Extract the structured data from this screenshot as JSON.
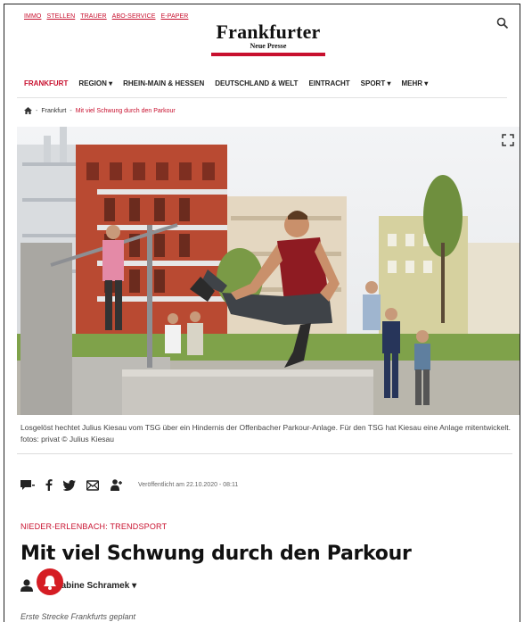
{
  "header": {
    "top_links": [
      "IMMO",
      "STELLEN",
      "TRAUER",
      "ABO-SERVICE",
      "E-PAPER"
    ],
    "logo_title": "Frankfurter",
    "logo_subtitle": "Neue Presse"
  },
  "nav": {
    "items": [
      "FRANKFURT",
      "REGION ▾",
      "RHEIN-MAIN & HESSEN",
      "DEUTSCHLAND & WELT",
      "EINTRACHT",
      "SPORT ▾",
      "MEHR ▾"
    ],
    "active_index": 0
  },
  "breadcrumb": {
    "sep": "-",
    "items": [
      "Frankfurt",
      "Mit viel Schwung durch den Parkour"
    ]
  },
  "photo": {
    "caption": "Losgelöst hechtet Julius Kiesau vom TSG über ein Hindernis der Offenbacher Parkour-Anlage. Für den TSG hat Kiesau eine Anlage mitentwickelt. fotos: privat   © Julius Kiesau"
  },
  "article": {
    "published": "Veröffentlicht am 22.10.2020 - 08:11",
    "kicker": "NIEDER-ERLENBACH: TRENDSPORT",
    "headline": "Mit viel Schwung durch den Parkour",
    "author": "Von Sabine Schramek ▾",
    "teaser": "Erste Strecke Frankfurts geplant"
  },
  "colors": {
    "accent": "#c8102e",
    "text": "#222222"
  },
  "icons": [
    "search-icon",
    "home-icon",
    "expand-icon",
    "comment-icon",
    "facebook-icon",
    "twitter-icon",
    "email-icon",
    "person-icon",
    "bell-icon"
  ]
}
